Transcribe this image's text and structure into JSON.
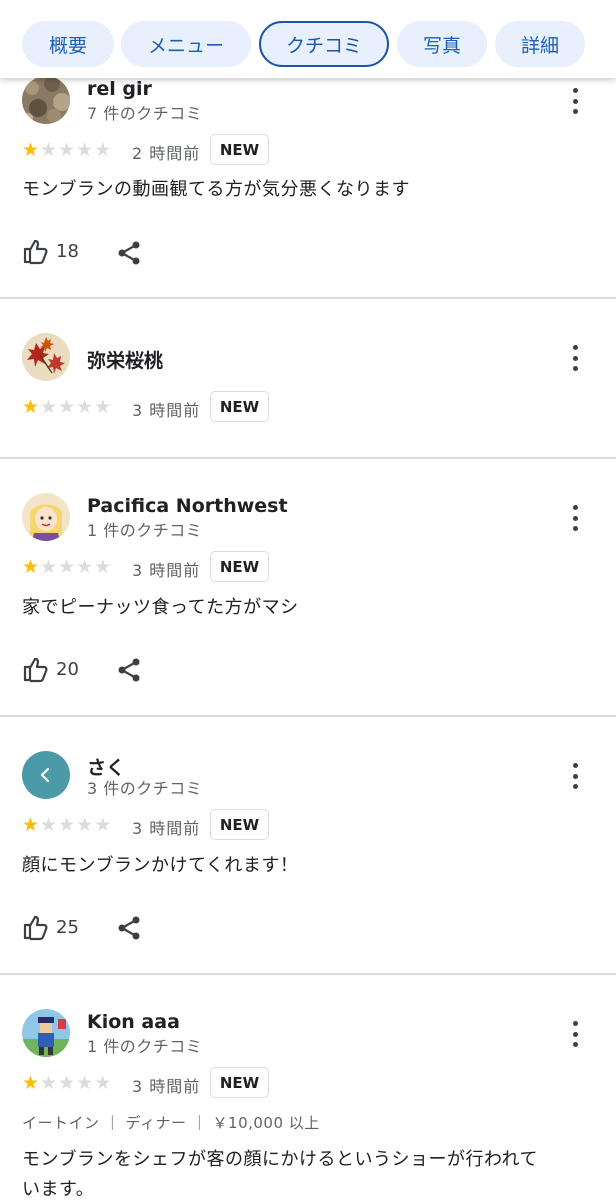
{
  "tabs": [
    {
      "label": "概要",
      "active": false
    },
    {
      "label": "メニュー",
      "active": false
    },
    {
      "label": "クチコミ",
      "active": true
    },
    {
      "label": "写真",
      "active": false
    },
    {
      "label": "詳細",
      "active": false
    }
  ],
  "new_badge": "NEW",
  "colors": {
    "accent": "#1a56a8",
    "chip_bg": "#e8f0fe",
    "star_on": "#fbbc04",
    "star_off": "#dadce0",
    "avatar_teal": "#4a9aa8"
  },
  "reviews": [
    {
      "name": "rel gir",
      "count": "7 件のクチコミ",
      "rating": 1,
      "time": "2 時間前",
      "text": "モンブランの動画観てる方が気分悪くなります",
      "likes": "18",
      "avatar_icon": "rock-photo-avatar"
    },
    {
      "name": "弥栄桜桃",
      "count": "",
      "rating": 1,
      "time": "3 時間前",
      "text": "",
      "likes": "",
      "avatar_icon": "maple-leaf-avatar"
    },
    {
      "name": "Pacifica Northwest",
      "count": "1 件のクチコミ",
      "rating": 1,
      "time": "3 時間前",
      "text": "家でピーナッツ食ってた方がマシ",
      "likes": "20",
      "avatar_icon": "cartoon-character-avatar"
    },
    {
      "name": "さく",
      "count": "3 件のクチコミ",
      "rating": 1,
      "time": "3 時間前",
      "text": "顔にモンブランかけてくれます！",
      "likes": "25",
      "avatar_icon": "chevron-left-icon"
    },
    {
      "name": "Kion aaa",
      "count": "1 件のクチコミ",
      "rating": 1,
      "time": "3 時間前",
      "meta": "イートイン ｜ ディナー ｜ ￥10,000 以上",
      "text_line1": "モンブランをシェフが客の顔にかけるというショーが行われて",
      "text_line2": "います。",
      "likes": "",
      "avatar_icon": "game-character-avatar"
    }
  ]
}
